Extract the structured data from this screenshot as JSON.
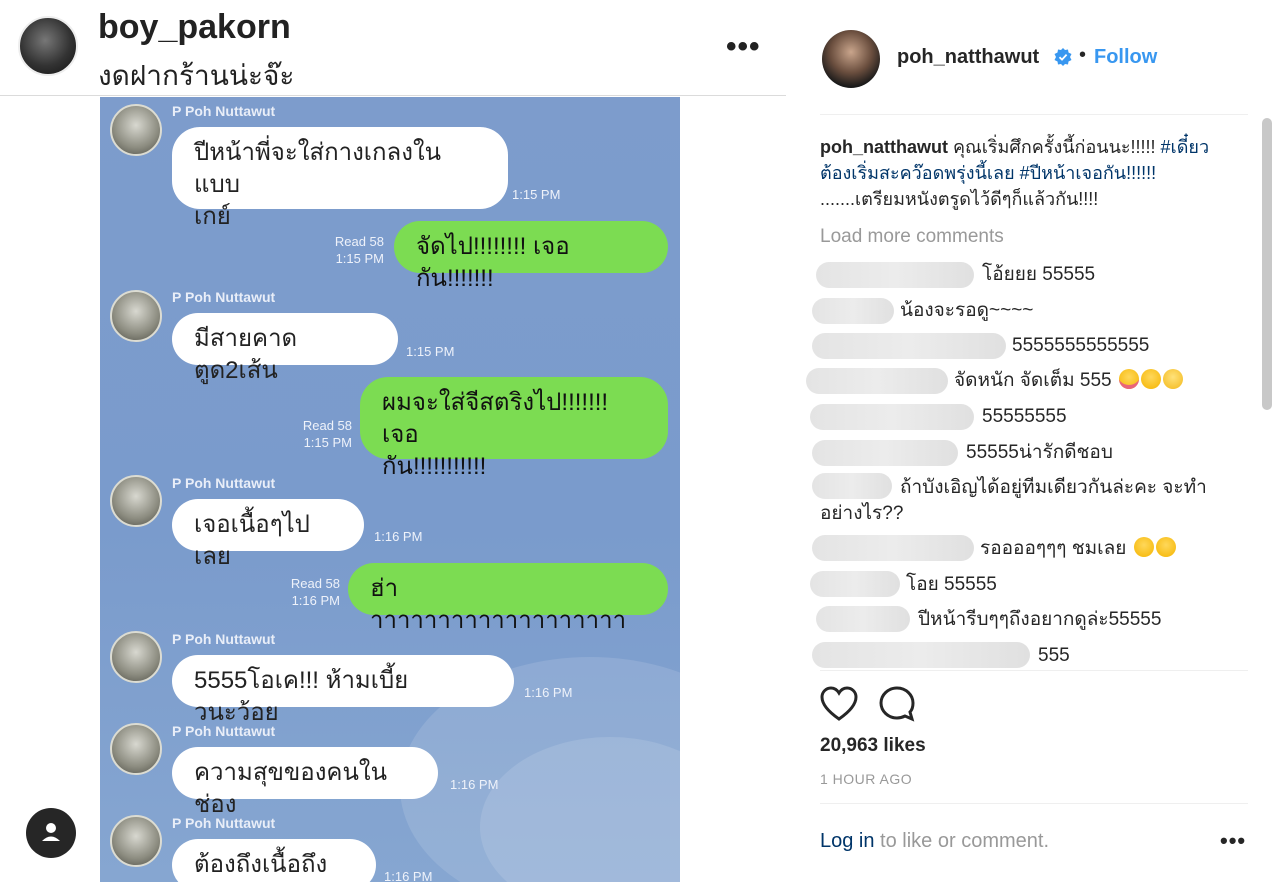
{
  "left_header": {
    "username": "boy_pakorn",
    "caption": "งดฝากร้านน่ะจ๊ะ",
    "more": "•••"
  },
  "chat": {
    "sender_name": "P Poh Nuttawut",
    "messages": [
      {
        "dir": "in",
        "text_line1": "ปีหน้าพี่จะใส่กางเกลงในแบบ",
        "text_line2": "เกย์",
        "time": "1:15 PM"
      },
      {
        "dir": "out",
        "text": "จัดไป!!!!!!!! เจอกัน!!!!!!!",
        "read": "Read 58",
        "time": "1:15 PM"
      },
      {
        "dir": "in",
        "text": "มีสายคาดตูด2เส้น",
        "time": "1:15 PM"
      },
      {
        "dir": "out",
        "text_line1": "ผมจะใส่จีสตริงไป!!!!!!! เจอ",
        "text_line2": "กัน!!!!!!!!!!!",
        "read": "Read 58",
        "time": "1:15 PM"
      },
      {
        "dir": "in",
        "text": "เจอเนื้อๆไปเลย",
        "time": "1:16 PM"
      },
      {
        "dir": "out",
        "text": "ฮ่าาาาาาาาาาาาาาาาาาาา",
        "read": "Read 58",
        "time": "1:16 PM"
      },
      {
        "dir": "in",
        "text": "5555โอเค!!! ห้ามเบี้ยวนะว้อย",
        "time": "1:16 PM"
      },
      {
        "dir": "in",
        "text": "ความสุขของคนในช่อง",
        "time": "1:16 PM"
      },
      {
        "dir": "in",
        "text": "ต้องถึงเนื้อถึงตัว",
        "time": "1:16 PM"
      }
    ]
  },
  "post": {
    "username": "poh_natthawut",
    "dot": "•",
    "follow_label": "Follow",
    "caption_user": "poh_natthawut",
    "caption_text1": " คุณเริ่มศึกครั้งนี้ก่อนนะ!!!!! ",
    "caption_tag1": "#เดี๋ยวต้องเริ่มสะคว๊อดพรุ่งนี้เลย",
    "caption_space": " ",
    "caption_tag2": "#ปีหน้าเจอกัน!!!!!!",
    "caption_text2": " .......เตรียมหนังตรูดไว้ดีๆก็แล้วกัน!!!!",
    "load_more": "Load more comments",
    "comments": [
      {
        "text": "โอ้ยยย 55555"
      },
      {
        "text": "น้องจะรอดู~~~~"
      },
      {
        "text": "5555555555555"
      },
      {
        "text": "จัดหนัก จัดเต็ม 555"
      },
      {
        "text": "55555555"
      },
      {
        "text": "55555น่ารักดีชอบ"
      },
      {
        "text": "ถ้าบังเอิญได้อยู่ทีมเดียวกันล่ะคะ จะทำ",
        "text2": "อย่างไร??"
      },
      {
        "text": "รออออๆๆๆ ชมเลย"
      },
      {
        "text": "โอย 55555"
      },
      {
        "text": "ปีหน้ารีบๆๆถึงอยากดูล่ะ55555"
      },
      {
        "text": "555"
      }
    ],
    "likes": "20,963 likes",
    "time_ago": "1 HOUR AGO",
    "login_link": "Log in",
    "login_rest": " to like or comment.",
    "more": "•••"
  }
}
